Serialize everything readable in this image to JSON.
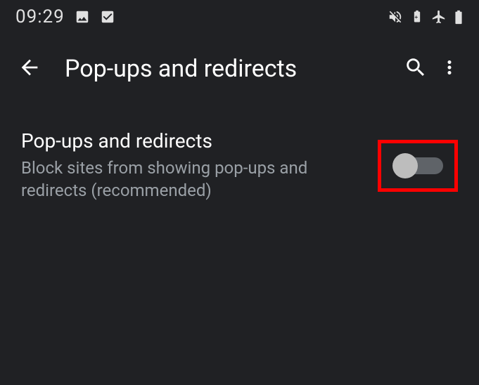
{
  "status": {
    "time": "09:29"
  },
  "appbar": {
    "title": "Pop-ups and redirects"
  },
  "setting": {
    "title": "Pop-ups and redirects",
    "subtitle": "Block sites from showing pop-ups and redirects (recommended)",
    "enabled": false
  }
}
